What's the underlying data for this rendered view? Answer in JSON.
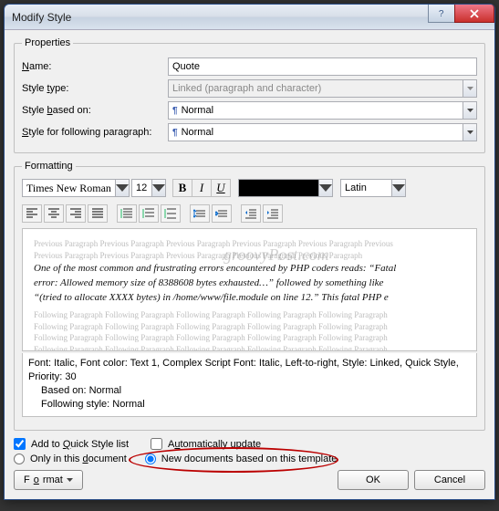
{
  "window": {
    "title": "Modify Style"
  },
  "props": {
    "legend": "Properties",
    "name_label_pre": "",
    "name_label_ul": "N",
    "name_label_post": "ame:",
    "name_value": "Quote",
    "type_label_pre": "Style ",
    "type_label_ul": "t",
    "type_label_post": "ype:",
    "type_value": "Linked (paragraph and character)",
    "based_label_pre": "Style ",
    "based_label_ul": "b",
    "based_label_post": "ased on:",
    "based_value": "Normal",
    "follow_label_pre": "",
    "follow_label_ul": "S",
    "follow_label_post": "tyle for following paragraph:",
    "follow_value": "Normal"
  },
  "formatting": {
    "legend": "Formatting",
    "font_name": "Times New Roman",
    "font_size": "12",
    "bold": "B",
    "italic": "I",
    "underline": "U",
    "script": "Latin",
    "font_color": "#000000"
  },
  "preview": {
    "grey_line": "Previous Paragraph Previous Paragraph Previous Paragraph Previous Paragraph Previous Paragraph Previous",
    "grey_line2": "Previous Paragraph Previous Paragraph Previous Paragraph Previous Paragraph Previous Paragraph",
    "main_l1": "One of the most common and frustrating errors encountered by PHP coders reads: “Fatal",
    "main_l2": "error: Allowed memory size of 8388608 bytes exhausted…” followed by something like",
    "main_l3": "“(tried to allocate XXXX bytes) in /home/www/file.module on line 12.” This fatal PHP e",
    "follow_line": "Following Paragraph Following Paragraph Following Paragraph Following Paragraph Following Paragraph",
    "watermark": "groovyPost.com"
  },
  "desc": {
    "l1": "Font: Italic, Font color: Text 1, Complex Script Font: Italic, Left-to-right, Style: Linked, Quick Style,",
    "l2": "Priority: 30",
    "l3": "Based on: Normal",
    "l4": "Following style: Normal"
  },
  "options": {
    "quick_ul": "Q",
    "quick_pre": "Add to ",
    "quick_post": "uick Style list",
    "auto_ul": "u",
    "auto_pre": "A",
    "auto_post": "tomatically update",
    "only_ul": "d",
    "only_pre": "Only in this ",
    "only_post": "ocument",
    "newdoc": "New documents based on this template"
  },
  "buttons": {
    "format_pre": "F",
    "format_ul": "o",
    "format_post": "rmat",
    "ok": "OK",
    "cancel": "Cancel"
  }
}
